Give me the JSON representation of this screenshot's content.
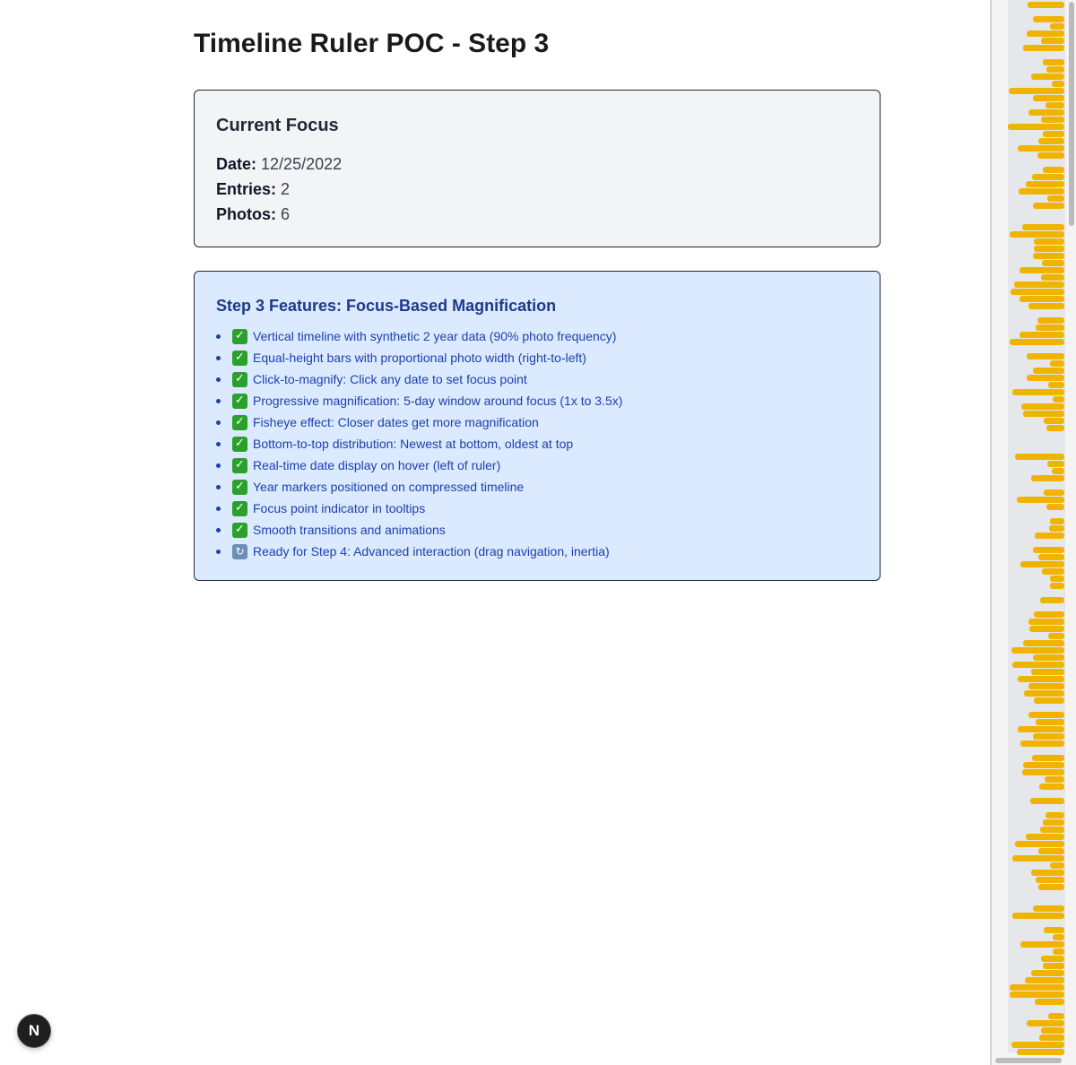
{
  "page": {
    "title": "Timeline Ruler POC - Step 3"
  },
  "focus": {
    "heading": "Current Focus",
    "date_label": "Date:",
    "date_value": "12/25/2022",
    "entries_label": "Entries:",
    "entries_value": "2",
    "photos_label": "Photos:",
    "photos_value": "6"
  },
  "features": {
    "heading": "Step 3 Features: Focus-Based Magnification",
    "items": [
      {
        "icon": "check-icon",
        "text": "Vertical timeline with synthetic 2 year data (90% photo frequency)"
      },
      {
        "icon": "check-icon",
        "text": "Equal-height bars with proportional photo width (right-to-left)"
      },
      {
        "icon": "check-icon",
        "text": "Click-to-magnify: Click any date to set focus point"
      },
      {
        "icon": "check-icon",
        "text": "Progressive magnification: 5-day window around focus (1x to 3.5x)"
      },
      {
        "icon": "check-icon",
        "text": "Fisheye effect: Closer dates get more magnification"
      },
      {
        "icon": "check-icon",
        "text": "Bottom-to-top distribution: Newest at bottom, oldest at top"
      },
      {
        "icon": "check-icon",
        "text": "Real-time date display on hover (left of ruler)"
      },
      {
        "icon": "check-icon",
        "text": "Year markers positioned on compressed timeline"
      },
      {
        "icon": "check-icon",
        "text": "Focus point indicator in tooltips"
      },
      {
        "icon": "check-icon",
        "text": "Smooth transitions and animations"
      },
      {
        "icon": "cycle-icon",
        "text": "Ready for Step 4: Advanced interaction (drag navigation, inertia)"
      }
    ]
  },
  "ruler": {
    "bar_color": "#f0b400",
    "track_color": "#e5e7eb"
  },
  "badge": {
    "label": "N"
  }
}
